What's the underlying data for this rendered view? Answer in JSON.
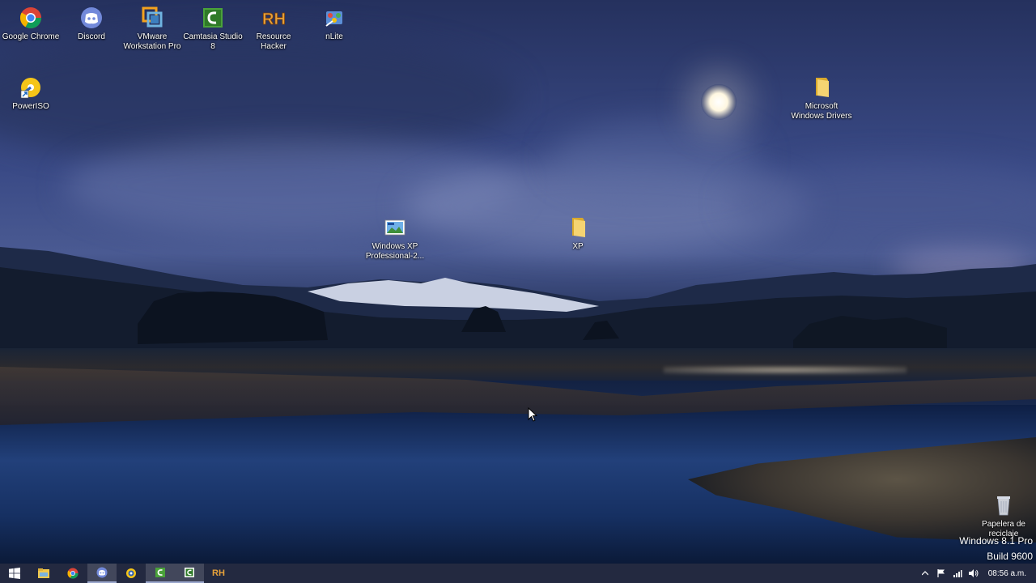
{
  "desktop": {
    "icons_row1": [
      {
        "label": "Google Chrome",
        "icon": "chrome-icon"
      },
      {
        "label": "Discord",
        "icon": "discord-icon"
      },
      {
        "label": "VMware Workstation Pro",
        "icon": "vmware-icon"
      },
      {
        "label": "Camtasia Studio 8",
        "icon": "camtasia-icon"
      },
      {
        "label": "Resource Hacker",
        "icon": "resource-hacker-icon"
      },
      {
        "label": "nLite",
        "icon": "nlite-icon"
      }
    ],
    "poweriso": {
      "label": "PowerISO",
      "icon": "poweriso-icon"
    },
    "ms_drivers": {
      "label": "Microsoft Windows Drivers",
      "icon": "folder-icon"
    },
    "winxp": {
      "label": "Windows XP Professional-2...",
      "icon": "image-file-icon"
    },
    "xp_folder": {
      "label": "XP",
      "icon": "folder-icon"
    },
    "recycle": {
      "label": "Papelera de reciclaje",
      "icon": "recycle-bin-icon"
    }
  },
  "watermark": {
    "line1": "Windows 8.1 Pro",
    "line2": "Build 9600"
  },
  "taskbar": {
    "clock": "08:56 a.m.",
    "pinned": [
      "start-icon",
      "file-explorer-icon",
      "chrome-icon",
      "discord-icon",
      "poweriso-icon",
      "camtasia-icon",
      "camtasia-recorder-icon",
      "resource-hacker-icon"
    ],
    "rh_text": "RH"
  },
  "colors": {
    "taskbar_bg": "#1a2038",
    "folder": "#f2c94c"
  }
}
